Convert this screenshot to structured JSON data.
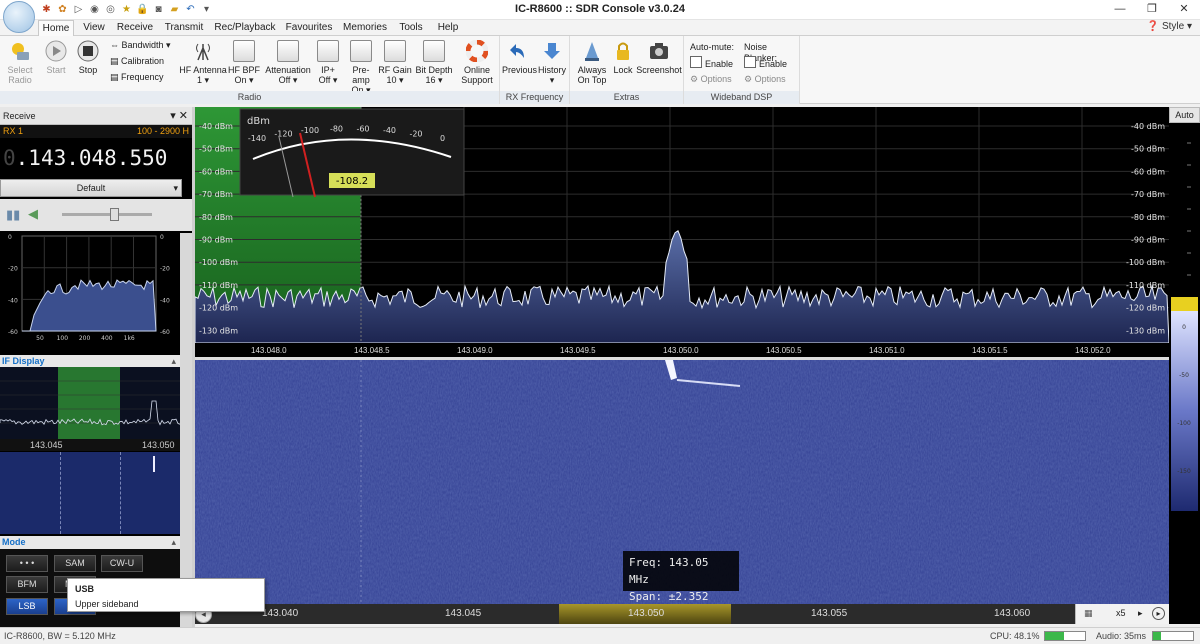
{
  "window": {
    "title": "IC-R8600 :: SDR Console v3.0.24",
    "style_menu": "Style"
  },
  "menu": {
    "tabs": [
      "Home",
      "View",
      "Receive",
      "Transmit",
      "Rec/Playback",
      "Favourites",
      "Memories",
      "Tools",
      "Help"
    ],
    "active": "Home"
  },
  "ribbon": {
    "select_radio": [
      "Select",
      "Radio"
    ],
    "start": "Start",
    "stop": "Stop",
    "bandwidth": "Bandwidth",
    "calibration": "Calibration",
    "frequency": "Frequency",
    "hf_antenna": [
      "HF Antenna",
      "1"
    ],
    "hf_bpf": [
      "HF BPF",
      "On"
    ],
    "attenuation": [
      "Attenuation",
      "Off"
    ],
    "ip_plus": [
      "IP+",
      "Off"
    ],
    "preamp": [
      "Pre-amp",
      "On"
    ],
    "rf_gain": [
      "RF Gain",
      "10"
    ],
    "bit_depth": [
      "Bit Depth",
      "16"
    ],
    "online_support": [
      "Online",
      "Support"
    ],
    "radio_group": "Radio",
    "previous": "Previous",
    "history": "History",
    "rx_frequency_group": "RX Frequency",
    "always_on_top": [
      "Always",
      "On Top"
    ],
    "lock": "Lock",
    "screenshot": "Screenshot",
    "extras_group": "Extras",
    "auto_mute": "Auto-mute:",
    "noise_blanker": "Noise Blanker:",
    "enable": "Enable",
    "options": "Options",
    "wideband_dsp_group": "Wideband DSP"
  },
  "receive": {
    "header": "Receive",
    "rx_label": "RX 1",
    "bandwidth_range": "100 - 2900 H",
    "frequency_dim": "0",
    "frequency": ".143.048.550",
    "preset": "Default"
  },
  "small_spectrum": {
    "x_ticks": [
      "50",
      "100",
      "200",
      "400",
      "1k6"
    ],
    "y_ticks": [
      "0",
      "-20",
      "-40",
      "-60"
    ]
  },
  "if_display": {
    "header": "IF Display",
    "left_freq": "143.045",
    "right_freq": "143.050"
  },
  "mode": {
    "header": "Mode",
    "buttons": [
      "• • •",
      "SAM",
      "CW-U",
      "BFM",
      "M",
      "LSB"
    ],
    "selected": "LSB"
  },
  "tooltip": {
    "title": "USB",
    "description": "Upper sideband"
  },
  "meter": {
    "unit": "dBm",
    "scale": [
      "-140",
      "-120",
      "-100",
      "-80",
      "-60",
      "-40",
      "-20",
      "0"
    ],
    "reading": "-108.2",
    "reading_value": -108.2
  },
  "spectrum": {
    "db_labels": [
      "-40 dBm",
      "-50 dBm",
      "-60 dBm",
      "-70 dBm",
      "-80 dBm",
      "-90 dBm",
      "-100 dBm",
      "-110 dBm",
      "-120 dBm",
      "-130 dBm"
    ],
    "freq_labels": [
      "143.048.0",
      "143.048.5",
      "143.049.0",
      "143.049.5",
      "143.050.0",
      "143.050.5",
      "143.051.0",
      "143.051.5",
      "143.052.0"
    ],
    "auto_button": "Auto"
  },
  "waterfall": {
    "bottom_labels": [
      "143.040",
      "143.045",
      "143.050",
      "143.055",
      "143.060"
    ],
    "zoom": "x5",
    "tooltip_freq": "Freq: 143.05 MHz",
    "tooltip_span": "Span: ±2.352 kHz",
    "scale_labels": [
      "0",
      "-50",
      "-100",
      "-150"
    ]
  },
  "status": {
    "left": "IC-R8600, BW = 5.120 MHz",
    "cpu": "CPU: 48.1%",
    "audio": "Audio: 35ms"
  },
  "colors": {
    "accent_blue": "#1570c8",
    "meter_bg": "#1a1a1a",
    "filter_green": "#2f9a3a",
    "waterfall_blue": "#2a3680"
  }
}
